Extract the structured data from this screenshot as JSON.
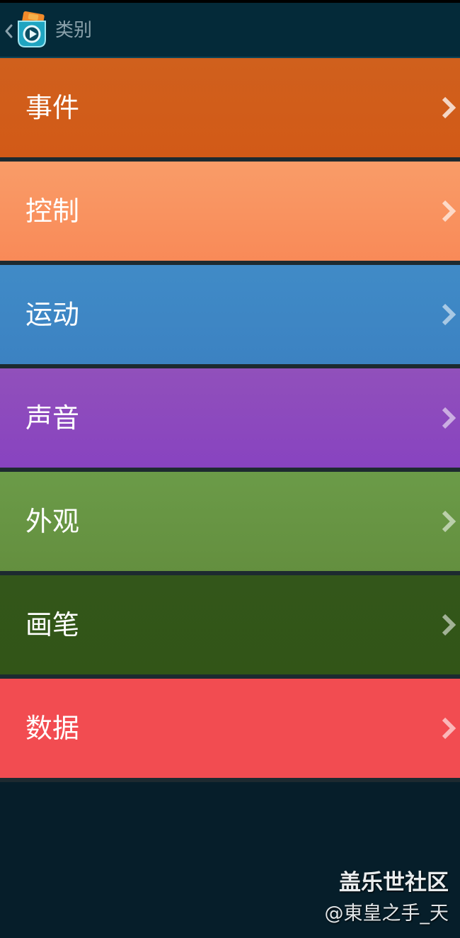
{
  "appbar": {
    "title": "类别",
    "back_icon": "chevron-left-icon",
    "logo_icon": "play-badge-logo-icon"
  },
  "categories": [
    {
      "label": "事件",
      "color_top": "#d0601d",
      "color_bottom": "#d25a17",
      "chevron_icon": "chevron-right-icon"
    },
    {
      "label": "控制",
      "color_top": "#f99c68",
      "color_bottom": "#f98a58",
      "chevron_icon": "chevron-right-icon"
    },
    {
      "label": "运动",
      "color_top": "#408bc7",
      "color_bottom": "#3c82c2",
      "chevron_icon": "chevron-right-icon"
    },
    {
      "label": "声音",
      "color_top": "#9150bb",
      "color_bottom": "#8843c0",
      "chevron_icon": "chevron-right-icon"
    },
    {
      "label": "外观",
      "color_top": "#6b9b48",
      "color_bottom": "#648f3f",
      "chevron_icon": "chevron-right-icon"
    },
    {
      "label": "画笔",
      "color_top": "#33561a",
      "color_bottom": "#325517",
      "chevron_icon": "chevron-right-icon"
    },
    {
      "label": "数据",
      "color_top": "#f24c51",
      "color_bottom": "#f24c51",
      "chevron_icon": "chevron-right-icon"
    }
  ],
  "watermark": {
    "title": "盖乐世社区",
    "user": "@東皇之手_天"
  },
  "colors": {
    "appbar_bg": "#042a39",
    "page_bg": "#061e2a",
    "appbar_title": "#8aa1ab"
  }
}
